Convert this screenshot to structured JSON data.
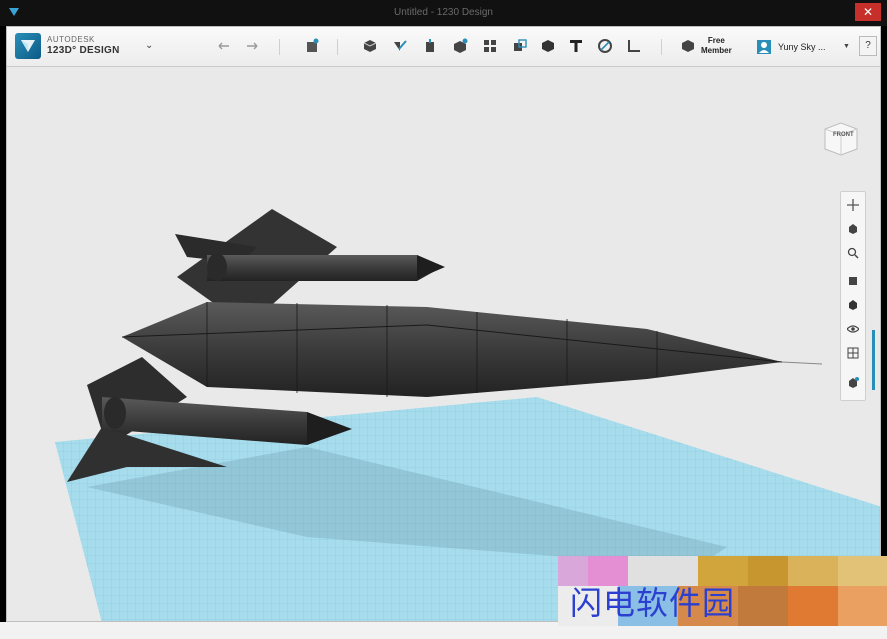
{
  "window": {
    "title": "Untitled - 1230 Design"
  },
  "app": {
    "brand": "AUTODESK",
    "product": "123D° DESIGN"
  },
  "member": {
    "line1": "Free",
    "line2": "Member"
  },
  "user": {
    "name": "Yuny Sky ..."
  },
  "help": {
    "label": "?"
  },
  "viewcube": {
    "label": "FRONT"
  },
  "watermark": {
    "text": "闪电软件园"
  },
  "toolbar_icons": [
    "undo-icon",
    "redo-icon",
    "transform-icon",
    "primitives-icon",
    "sketch-icon",
    "construct-icon",
    "modify-icon",
    "pattern-icon",
    "grouping-icon",
    "combine-icon",
    "measure-icon",
    "text-icon",
    "snap-icon",
    "material-icon",
    "members-icon",
    "avatar-icon"
  ],
  "colors": {
    "accent": "#2a8fb8",
    "grid": "#9fd9ea",
    "model": "#3d3d3d",
    "close": "#c7302a"
  }
}
